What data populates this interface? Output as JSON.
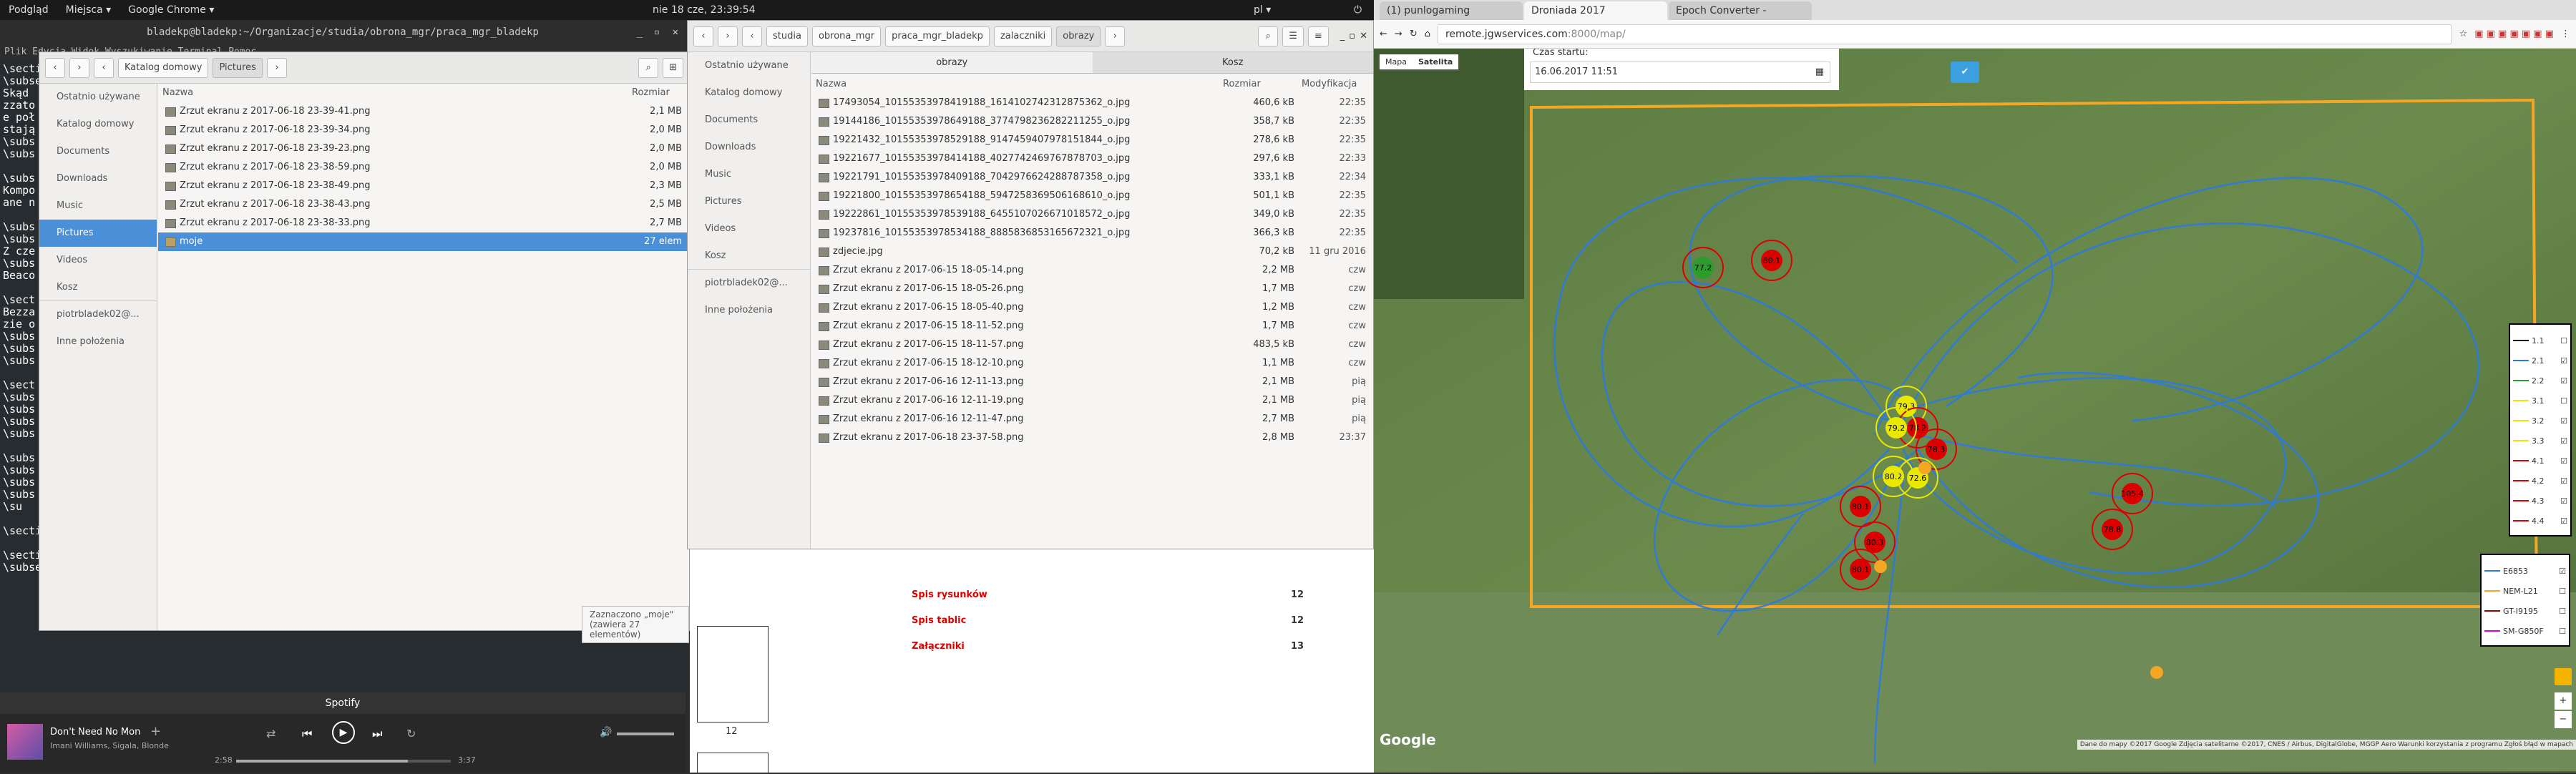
{
  "topbar": {
    "left": [
      "Podgląd",
      "Miejsca ▾",
      "Google Chrome ▾"
    ],
    "clock": "nie 18 cze, 23:39:54",
    "lang": "pl ▾"
  },
  "terminal": {
    "title": "bladekp@bladekp:~/Organizacje/studia/obrona_mgr/praca_mgr_bladekp",
    "menu": "Plik  Edycja  Widok  Wyszukiwanie  Terminal  Pomoc",
    "lines": [
      "\\section",
      "\\subsection",
      "Skąd ",
      "zzato",
      "e poł",
      "stają",
      "\\subs",
      "\\subs",
      "",
      "\\subs",
      "Kompo",
      "ane n",
      "",
      "\\subs",
      "\\subs",
      "Z cze",
      "\\subs",
      "Beaco",
      "",
      "\\sect",
      "Bezza",
      "zie o",
      "\\subs",
      "\\subs",
      "\\subs",
      "",
      "\\sect",
      "\\subs",
      "\\subs",
      "\\subs",
      "\\subs",
      "",
      "\\subs",
      "\\subs",
      "\\subs",
      "\\subs",
      "\\su",
      "",
      "\\section{Konkurs}",
      "",
      "\\section{Podsumowanie}",
      "\\subsection{Wnioski}"
    ]
  },
  "spotify": {
    "title": "Spotify",
    "song": "Don't Need No Mon",
    "artist": "Imani Williams, Sigala, Blonde",
    "time_elapsed": "2:58",
    "time_total": "3:37",
    "progress": 0.8
  },
  "fm1": {
    "path": [
      "Katalog domowy",
      "Pictures"
    ],
    "sidebar": [
      "Ostatnio używane",
      "Katalog domowy",
      "Documents",
      "Downloads",
      "Music",
      "Pictures",
      "Videos",
      "Kosz",
      "piotrbladek02@...",
      "Inne położenia"
    ],
    "col_name": "Nazwa",
    "col_size": "Rozmiar",
    "rows": [
      {
        "n": "Zrzut ekranu z 2017-06-18 23-39-41.png",
        "s": "2,1 MB"
      },
      {
        "n": "Zrzut ekranu z 2017-06-18 23-39-34.png",
        "s": "2,0 MB"
      },
      {
        "n": "Zrzut ekranu z 2017-06-18 23-39-23.png",
        "s": "2,0 MB"
      },
      {
        "n": "Zrzut ekranu z 2017-06-18 23-38-59.png",
        "s": "2,0 MB"
      },
      {
        "n": "Zrzut ekranu z 2017-06-18 23-38-49.png",
        "s": "2,3 MB"
      },
      {
        "n": "Zrzut ekranu z 2017-06-18 23-38-43.png",
        "s": "2,5 MB"
      },
      {
        "n": "Zrzut ekranu z 2017-06-18 23-38-33.png",
        "s": "2,7 MB"
      },
      {
        "n": "moje",
        "s": "27 elem"
      }
    ],
    "status": "Zaznaczono „moje\" (zawiera 27 elementów)"
  },
  "fm2": {
    "path": [
      "studia",
      "obrona_mgr",
      "praca_mgr_bladekp",
      "zalaczniki",
      "obrazy"
    ],
    "sidebar": [
      "Ostatnio używane",
      "Katalog domowy",
      "Documents",
      "Downloads",
      "Music",
      "Pictures",
      "Videos",
      "Kosz",
      "piotrbladek02@...",
      "Inne położenia"
    ],
    "tabs": [
      "obrazy",
      "Kosz"
    ],
    "col_name": "Nazwa",
    "col_size": "Rozmiar",
    "col_mod": "Modyfikacja",
    "rows": [
      {
        "n": "17493054_10155353978419188_1614102742312875362_o.jpg",
        "s": "460,6 kB",
        "m": "22:35"
      },
      {
        "n": "19144186_10155353978649188_3774798236282211255_o.jpg",
        "s": "358,7 kB",
        "m": "22:35"
      },
      {
        "n": "19221432_10155353978529188_9147459407978151844_o.jpg",
        "s": "278,6 kB",
        "m": "22:35"
      },
      {
        "n": "19221677_10155353978414188_4027742469767878703_o.jpg",
        "s": "297,6 kB",
        "m": "22:33"
      },
      {
        "n": "19221791_10155353978409188_7042976624288787358_o.jpg",
        "s": "333,1 kB",
        "m": "22:34"
      },
      {
        "n": "19221800_10155353978654188_5947258369506168610_o.jpg",
        "s": "501,1 kB",
        "m": "22:35"
      },
      {
        "n": "19222861_10155353978539188_6455107026671018572_o.jpg",
        "s": "349,0 kB",
        "m": "22:35"
      },
      {
        "n": "19237816_10155353978534188_8885836853165672321_o.jpg",
        "s": "366,3 kB",
        "m": "22:35"
      },
      {
        "n": "zdjecie.jpg",
        "s": "70,2 kB",
        "m": "11 gru 2016"
      },
      {
        "n": "Zrzut ekranu z 2017-06-15 18-05-14.png",
        "s": "2,2 MB",
        "m": "czw"
      },
      {
        "n": "Zrzut ekranu z 2017-06-15 18-05-26.png",
        "s": "1,7 MB",
        "m": "czw"
      },
      {
        "n": "Zrzut ekranu z 2017-06-15 18-05-40.png",
        "s": "1,2 MB",
        "m": "czw"
      },
      {
        "n": "Zrzut ekranu z 2017-06-15 18-11-52.png",
        "s": "1,7 MB",
        "m": "czw"
      },
      {
        "n": "Zrzut ekranu z 2017-06-15 18-11-57.png",
        "s": "483,5 kB",
        "m": "czw"
      },
      {
        "n": "Zrzut ekranu z 2017-06-15 18-12-10.png",
        "s": "1,1 MB",
        "m": "czw"
      },
      {
        "n": "Zrzut ekranu z 2017-06-16 12-11-13.png",
        "s": "2,1 MB",
        "m": "pią"
      },
      {
        "n": "Zrzut ekranu z 2017-06-16 12-11-19.png",
        "s": "2,1 MB",
        "m": "pią"
      },
      {
        "n": "Zrzut ekranu z 2017-06-16 12-11-47.png",
        "s": "2,7 MB",
        "m": "pią"
      },
      {
        "n": "Zrzut ekranu z 2017-06-18 23-37-58.png",
        "s": "2,8 MB",
        "m": "23:37"
      }
    ]
  },
  "doc": {
    "entries": [
      {
        "t": "Spis rysunków",
        "p": "12"
      },
      {
        "t": "Spis tablic",
        "p": "12"
      },
      {
        "t": "Załączniki",
        "p": "13"
      }
    ],
    "page": "12"
  },
  "chrome": {
    "tabs": [
      "(1) punlogaming",
      "Droniada 2017",
      "Epoch Converter -"
    ],
    "url": "remote.jgwservices.com:8000/map/",
    "url_host": "remote.jgwservices.com",
    "url_rest": ":8000/map/",
    "map_types": [
      "Mapa",
      "Satelita"
    ],
    "start_label": "Czas startu:",
    "start_value": "16.06.2017 11:51",
    "legend1": [
      "1.1",
      "2.1",
      "2.2",
      "3.1",
      "3.2",
      "3.3",
      "4.1",
      "4.2",
      "4.3",
      "4.4"
    ],
    "legend2": [
      "E6853",
      "NEM-L21",
      "GT-I9195",
      "SM-G850F"
    ],
    "footer": "Dane do mapy ©2017 Google  Zdjęcia satelitarne ©2017, CNES / Airbus, DigitalGlobe, MGGP Aero  Warunki korzystania z programu  Zgłoś błąd w mapach",
    "google": "Google",
    "markers": [
      "77.2",
      "80.1",
      "79.3",
      "78.2",
      "79.2",
      "78.3",
      "80.2",
      "80.1",
      "80.3",
      "80.1",
      "105.4",
      "78.8",
      "72.6"
    ]
  }
}
